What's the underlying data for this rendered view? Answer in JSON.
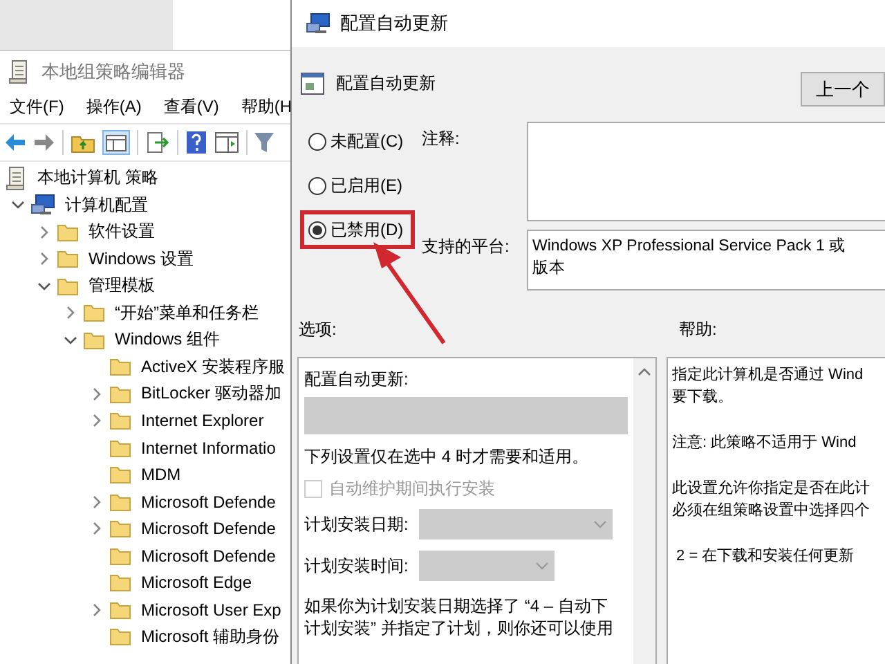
{
  "main_window": {
    "title": "本地组策略编辑器",
    "menu": [
      "文件(F)",
      "操作(A)",
      "查看(V)",
      "帮助(H"
    ],
    "tree": [
      {
        "label": "本地计算机 策略",
        "children": [
          {
            "label": "计算机配置",
            "kind": "branch",
            "expanded": true,
            "children": [
              {
                "label": "软件设置",
                "kind": "branch",
                "expanded": false
              },
              {
                "label": "Windows 设置",
                "kind": "branch",
                "expanded": false
              },
              {
                "label": "管理模板",
                "kind": "branch",
                "expanded": true,
                "children": [
                  {
                    "label": "“开始”菜单和任务栏",
                    "kind": "branch",
                    "expanded": false
                  },
                  {
                    "label": "Windows 组件",
                    "kind": "branch",
                    "expanded": true,
                    "children": [
                      {
                        "label": "ActiveX 安装程序服",
                        "kind": "plain"
                      },
                      {
                        "label": "BitLocker 驱动器加",
                        "kind": "branch",
                        "expanded": false
                      },
                      {
                        "label": "Internet Explorer",
                        "kind": "branch",
                        "expanded": false
                      },
                      {
                        "label": "Internet Informatio",
                        "kind": "plain"
                      },
                      {
                        "label": "MDM",
                        "kind": "plain"
                      },
                      {
                        "label": "Microsoft Defende",
                        "kind": "branch",
                        "expanded": false
                      },
                      {
                        "label": "Microsoft Defende",
                        "kind": "branch",
                        "expanded": false
                      },
                      {
                        "label": "Microsoft Defende",
                        "kind": "plain"
                      },
                      {
                        "label": "Microsoft Edge",
                        "kind": "plain"
                      },
                      {
                        "label": "Microsoft User Exp",
                        "kind": "branch",
                        "expanded": false
                      },
                      {
                        "label": "Microsoft 辅助身份",
                        "kind": "plain"
                      }
                    ]
                  }
                ]
              }
            ]
          }
        ]
      }
    ]
  },
  "dialog": {
    "title": "配置自动更新",
    "setting_name": "配置自动更新",
    "prev_button": "上一个",
    "states": [
      {
        "label": "未配置(C)",
        "selected": false,
        "highlighted": false
      },
      {
        "label": "已启用(E)",
        "selected": false,
        "highlighted": false
      },
      {
        "label": "已禁用(D)",
        "selected": true,
        "highlighted": true
      }
    ],
    "comment_label": "注释:",
    "platform_label": "支持的平台:",
    "platform_lines": [
      "Windows XP Professional Service Pack 1 或",
      "版本"
    ],
    "options_label": "选项:",
    "help_label": "帮助:",
    "options": [
      {
        "kind": "heading",
        "text": "配置自动更新:"
      },
      {
        "kind": "dropdown",
        "disabled": true
      },
      {
        "kind": "note",
        "text": "下列设置仅在选中 4 时才需要和适用。"
      },
      {
        "kind": "checkbox",
        "text": "自动维护期间执行安装",
        "checked": false,
        "disabled": true
      },
      {
        "kind": "select",
        "label": "计划安装日期:",
        "disabled": true,
        "wide": true
      },
      {
        "kind": "select",
        "label": "计划安装时间:",
        "disabled": true,
        "wide": false
      },
      {
        "kind": "paragraph",
        "lines": [
          "如果你为计划安装日期选择了 “4 – 自动下",
          "计划安装” 并指定了计划，则你还可以使用"
        ]
      }
    ],
    "help": [
      [
        "指定此计算机是否通过 Wind",
        "要下载。"
      ],
      [
        "注意: 此策略不适用于 Wind"
      ],
      [
        "此设置允许你指定是否在此计",
        "必须在组策略设置中选择四个"
      ],
      [
        " 2 = 在下载和安装任何更新"
      ]
    ]
  }
}
